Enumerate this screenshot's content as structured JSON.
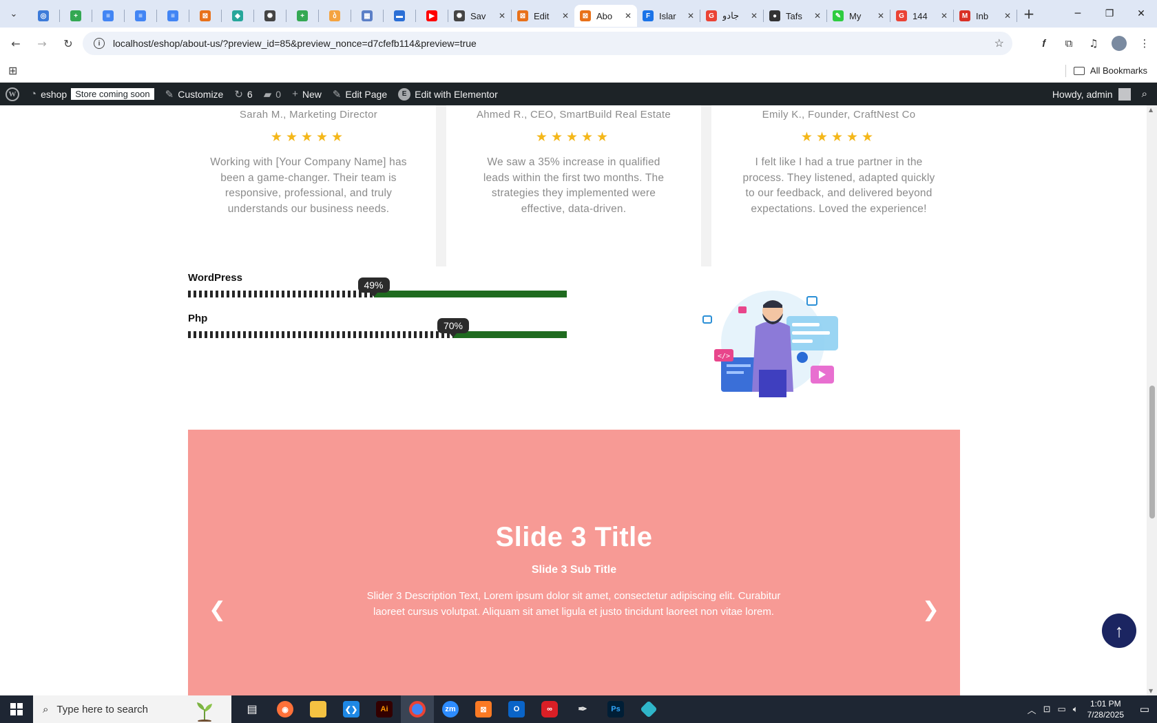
{
  "browser": {
    "tabs": [
      {
        "label": "",
        "color": "#3d7bd9",
        "glyph": "◎"
      },
      {
        "label": "",
        "color": "#34a853",
        "glyph": "+"
      },
      {
        "label": "",
        "color": "#4285f4",
        "glyph": "≡"
      },
      {
        "label": "",
        "color": "#4285f4",
        "glyph": "≡"
      },
      {
        "label": "",
        "color": "#4285f4",
        "glyph": "≡"
      },
      {
        "label": "",
        "color": "#e8711a",
        "glyph": "⊠"
      },
      {
        "label": "",
        "color": "#26a69a",
        "glyph": "◆"
      },
      {
        "label": "",
        "color": "#444444",
        "glyph": "✺"
      },
      {
        "label": "",
        "color": "#34a853",
        "glyph": "+"
      },
      {
        "label": "",
        "color": "#f4a340",
        "glyph": "ბ"
      },
      {
        "label": "",
        "color": "#5b7fc7",
        "glyph": "▦"
      },
      {
        "label": "",
        "color": "#2b6fd6",
        "glyph": "▬"
      },
      {
        "label": "",
        "color": "#ff0000",
        "glyph": "▶"
      },
      {
        "label": "Sav",
        "color": "#444444",
        "glyph": "✺"
      },
      {
        "label": "Edit",
        "color": "#e8711a",
        "glyph": "⊠"
      },
      {
        "label": "Abo",
        "color": "#e8711a",
        "glyph": "⊠",
        "active": true
      },
      {
        "label": "Islar",
        "color": "#1a73e8",
        "glyph": "F"
      },
      {
        "label": "جادو",
        "color": "#ea4335",
        "glyph": "G"
      },
      {
        "label": "Tafs",
        "color": "#333333",
        "glyph": "●"
      },
      {
        "label": "My",
        "color": "#2ecc40",
        "glyph": "✎"
      },
      {
        "label": "144",
        "color": "#ea4335",
        "glyph": "G"
      },
      {
        "label": "Inb",
        "color": "#d93025",
        "glyph": "M"
      }
    ],
    "url": "localhost/eshop/about-us/?preview_id=85&preview_nonce=d7cfefb114&preview=true",
    "all_bookmarks": "All Bookmarks"
  },
  "wpbar": {
    "site": "eshop",
    "store_badge": "Store coming soon",
    "customize": "Customize",
    "updates": "6",
    "comments": "0",
    "new": "New",
    "edit_page": "Edit Page",
    "edit_elementor": "Edit with Elementor",
    "howdy": "Howdy, admin"
  },
  "testimonials": [
    {
      "author": "Sarah M., Marketing Director",
      "stars": "★★★★★",
      "text": "Working with [Your Company Name] has been a game-changer. Their team is responsive, professional, and truly understands our business needs."
    },
    {
      "author": "Ahmed R., CEO, SmartBuild Real Estate",
      "stars": "★★★★★",
      "text": "We saw a 35% increase in qualified leads within the first two months. The strategies they implemented were effective, data-driven."
    },
    {
      "author": "Emily K., Founder, CraftNest Co",
      "stars": "★★★★★",
      "text": "I felt like I had a true partner in the process. They listened, adapted quickly to our feedback, and delivered beyond expectations. Loved the experience!"
    }
  ],
  "skills": [
    {
      "name": "WordPress",
      "percent": 49,
      "label": "49%"
    },
    {
      "name": "Php",
      "percent": 70,
      "label": "70%"
    }
  ],
  "slider": {
    "title": "Slide 3 Title",
    "subtitle": "Slide 3 Sub Title",
    "description": "Slider 3 Description Text, Lorem ipsum dolor sit amet, consectetur adipiscing elit. Curabitur laoreet cursus volutpat. Aliquam sit amet ligula et justo tincidunt laoreet non vitae lorem.",
    "background": "#f79a95"
  },
  "taskbar": {
    "search_placeholder": "Type here to search",
    "time": "1:01 PM",
    "date": "7/28/2025"
  },
  "colors": {
    "star": "#f4b71a",
    "skill_fill": "#1f6b1f",
    "to_top": "#1b2561",
    "wp_bar": "#1d2327"
  }
}
